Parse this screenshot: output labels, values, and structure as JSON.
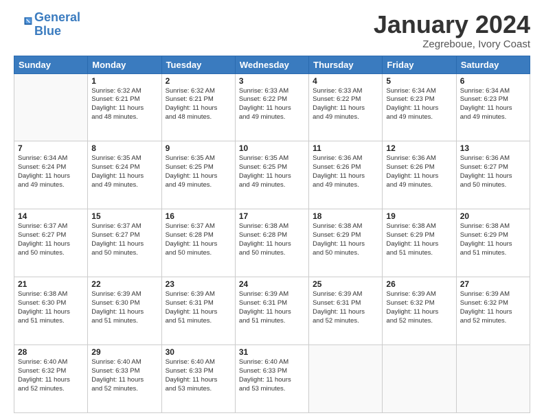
{
  "header": {
    "logo_text_general": "General",
    "logo_text_blue": "Blue",
    "month_title": "January 2024",
    "subtitle": "Zegreboue, Ivory Coast"
  },
  "weekdays": [
    "Sunday",
    "Monday",
    "Tuesday",
    "Wednesday",
    "Thursday",
    "Friday",
    "Saturday"
  ],
  "weeks": [
    [
      {
        "day": "",
        "info": ""
      },
      {
        "day": "1",
        "info": "Sunrise: 6:32 AM\nSunset: 6:21 PM\nDaylight: 11 hours\nand 48 minutes."
      },
      {
        "day": "2",
        "info": "Sunrise: 6:32 AM\nSunset: 6:21 PM\nDaylight: 11 hours\nand 48 minutes."
      },
      {
        "day": "3",
        "info": "Sunrise: 6:33 AM\nSunset: 6:22 PM\nDaylight: 11 hours\nand 49 minutes."
      },
      {
        "day": "4",
        "info": "Sunrise: 6:33 AM\nSunset: 6:22 PM\nDaylight: 11 hours\nand 49 minutes."
      },
      {
        "day": "5",
        "info": "Sunrise: 6:34 AM\nSunset: 6:23 PM\nDaylight: 11 hours\nand 49 minutes."
      },
      {
        "day": "6",
        "info": "Sunrise: 6:34 AM\nSunset: 6:23 PM\nDaylight: 11 hours\nand 49 minutes."
      }
    ],
    [
      {
        "day": "7",
        "info": "Sunrise: 6:34 AM\nSunset: 6:24 PM\nDaylight: 11 hours\nand 49 minutes."
      },
      {
        "day": "8",
        "info": "Sunrise: 6:35 AM\nSunset: 6:24 PM\nDaylight: 11 hours\nand 49 minutes."
      },
      {
        "day": "9",
        "info": "Sunrise: 6:35 AM\nSunset: 6:25 PM\nDaylight: 11 hours\nand 49 minutes."
      },
      {
        "day": "10",
        "info": "Sunrise: 6:35 AM\nSunset: 6:25 PM\nDaylight: 11 hours\nand 49 minutes."
      },
      {
        "day": "11",
        "info": "Sunrise: 6:36 AM\nSunset: 6:26 PM\nDaylight: 11 hours\nand 49 minutes."
      },
      {
        "day": "12",
        "info": "Sunrise: 6:36 AM\nSunset: 6:26 PM\nDaylight: 11 hours\nand 49 minutes."
      },
      {
        "day": "13",
        "info": "Sunrise: 6:36 AM\nSunset: 6:27 PM\nDaylight: 11 hours\nand 50 minutes."
      }
    ],
    [
      {
        "day": "14",
        "info": "Sunrise: 6:37 AM\nSunset: 6:27 PM\nDaylight: 11 hours\nand 50 minutes."
      },
      {
        "day": "15",
        "info": "Sunrise: 6:37 AM\nSunset: 6:27 PM\nDaylight: 11 hours\nand 50 minutes."
      },
      {
        "day": "16",
        "info": "Sunrise: 6:37 AM\nSunset: 6:28 PM\nDaylight: 11 hours\nand 50 minutes."
      },
      {
        "day": "17",
        "info": "Sunrise: 6:38 AM\nSunset: 6:28 PM\nDaylight: 11 hours\nand 50 minutes."
      },
      {
        "day": "18",
        "info": "Sunrise: 6:38 AM\nSunset: 6:29 PM\nDaylight: 11 hours\nand 50 minutes."
      },
      {
        "day": "19",
        "info": "Sunrise: 6:38 AM\nSunset: 6:29 PM\nDaylight: 11 hours\nand 51 minutes."
      },
      {
        "day": "20",
        "info": "Sunrise: 6:38 AM\nSunset: 6:29 PM\nDaylight: 11 hours\nand 51 minutes."
      }
    ],
    [
      {
        "day": "21",
        "info": "Sunrise: 6:38 AM\nSunset: 6:30 PM\nDaylight: 11 hours\nand 51 minutes."
      },
      {
        "day": "22",
        "info": "Sunrise: 6:39 AM\nSunset: 6:30 PM\nDaylight: 11 hours\nand 51 minutes."
      },
      {
        "day": "23",
        "info": "Sunrise: 6:39 AM\nSunset: 6:31 PM\nDaylight: 11 hours\nand 51 minutes."
      },
      {
        "day": "24",
        "info": "Sunrise: 6:39 AM\nSunset: 6:31 PM\nDaylight: 11 hours\nand 51 minutes."
      },
      {
        "day": "25",
        "info": "Sunrise: 6:39 AM\nSunset: 6:31 PM\nDaylight: 11 hours\nand 52 minutes."
      },
      {
        "day": "26",
        "info": "Sunrise: 6:39 AM\nSunset: 6:32 PM\nDaylight: 11 hours\nand 52 minutes."
      },
      {
        "day": "27",
        "info": "Sunrise: 6:39 AM\nSunset: 6:32 PM\nDaylight: 11 hours\nand 52 minutes."
      }
    ],
    [
      {
        "day": "28",
        "info": "Sunrise: 6:40 AM\nSunset: 6:32 PM\nDaylight: 11 hours\nand 52 minutes."
      },
      {
        "day": "29",
        "info": "Sunrise: 6:40 AM\nSunset: 6:33 PM\nDaylight: 11 hours\nand 52 minutes."
      },
      {
        "day": "30",
        "info": "Sunrise: 6:40 AM\nSunset: 6:33 PM\nDaylight: 11 hours\nand 53 minutes."
      },
      {
        "day": "31",
        "info": "Sunrise: 6:40 AM\nSunset: 6:33 PM\nDaylight: 11 hours\nand 53 minutes."
      },
      {
        "day": "",
        "info": ""
      },
      {
        "day": "",
        "info": ""
      },
      {
        "day": "",
        "info": ""
      }
    ]
  ]
}
